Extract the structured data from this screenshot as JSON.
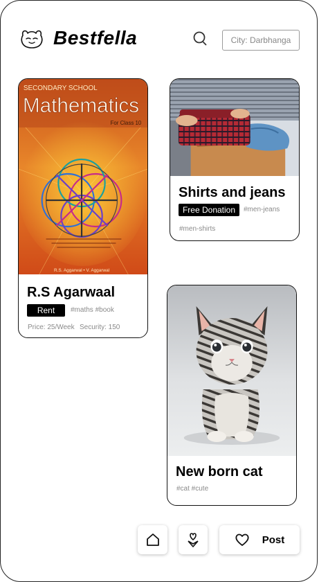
{
  "header": {
    "brand": "Bestfella",
    "logo_icon": "smiling-face-icon",
    "search_icon": "search-icon",
    "city_label": "City: Darbhanga"
  },
  "cards": [
    {
      "image": {
        "kind": "book-cover",
        "overline": "SECONDARY SCHOOL",
        "title": "Mathematics",
        "subtitle": "For Class 10",
        "authors": "R.S. Aggarwal • V. Aggarwal",
        "colors": {
          "top": "#c9541a",
          "mid": "#e8862a",
          "bottom": "#d04a18"
        }
      },
      "title": "R.S Agarwaal",
      "tag": "Rent",
      "hashtags": "#maths #book",
      "price": "Price: 25/Week",
      "security": "Security: 150"
    },
    {
      "image": {
        "kind": "clothes-photo"
      },
      "title": "Shirts and jeans",
      "tag": "Free Donation",
      "hashtags_inline": "#men-jeans",
      "hashtags": "#men-shirts"
    },
    {
      "image": {
        "kind": "kitten-photo"
      },
      "title": "New born cat",
      "hashtags": "#cat #cute"
    }
  ],
  "bottom_nav": {
    "home_icon": "home-icon",
    "donate_icon": "heart-hand-icon",
    "post_icon": "heart-icon",
    "post_label": "Post"
  },
  "colors": {
    "pill_bg": "#000000",
    "muted_text": "#8a8a8a",
    "border": "#111111"
  }
}
